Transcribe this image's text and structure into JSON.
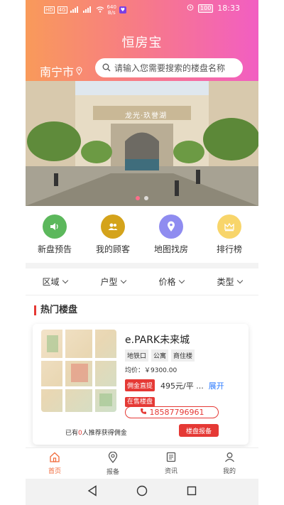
{
  "status_bar": {
    "carrier_tags": [
      "HD",
      "4G"
    ],
    "speed_value": "640",
    "speed_unit": "B/s",
    "app_badge": "♥",
    "battery": "100",
    "time": "18:33"
  },
  "header": {
    "title": "恒房宝",
    "city": "南宁市",
    "search_placeholder": "请输入您需要搜索的楼盘名称"
  },
  "banner": {
    "sign_text": "龙光·玖誉湖",
    "slide_count": 2,
    "active_slide": 1
  },
  "quick_menu": [
    {
      "label": "新盘预告",
      "icon": "speaker-icon",
      "color": "#5cb85c"
    },
    {
      "label": "我的顾客",
      "icon": "users-icon",
      "color": "#d4a31b"
    },
    {
      "label": "地图找房",
      "icon": "location-icon",
      "color": "#8f8cf0"
    },
    {
      "label": "排行榜",
      "icon": "crown-icon",
      "color": "#f8d56a"
    }
  ],
  "filters": [
    {
      "label": "区域"
    },
    {
      "label": "户型"
    },
    {
      "label": "价格"
    },
    {
      "label": "类型"
    }
  ],
  "hot_section": {
    "title": "热门楼盘"
  },
  "property": {
    "name": "e.PARK未来城",
    "tags": [
      "地铁口",
      "公寓",
      "商住楼"
    ],
    "avg_price": "均价：￥9300.00",
    "commission_tag": "佣金直提",
    "commission_value": "495元/平 ...",
    "expand": "展开",
    "status_tag": "在售楼盘",
    "phone": "18587796961",
    "recommend_prefix": "已有",
    "recommend_count": "0",
    "recommend_suffix": "人推荐获得佣金",
    "report_button": "楼盘报备"
  },
  "tabbar": [
    {
      "label": "首页",
      "icon": "home-icon",
      "active": true
    },
    {
      "label": "报备",
      "icon": "pin-icon",
      "active": false
    },
    {
      "label": "资讯",
      "icon": "news-icon",
      "active": false
    },
    {
      "label": "我的",
      "icon": "user-icon",
      "active": false
    }
  ],
  "colors": {
    "accent": "#e53935",
    "gradient_start": "#f99a5a",
    "gradient_end": "#f25ec2",
    "tab_active": "#f06a3a"
  }
}
